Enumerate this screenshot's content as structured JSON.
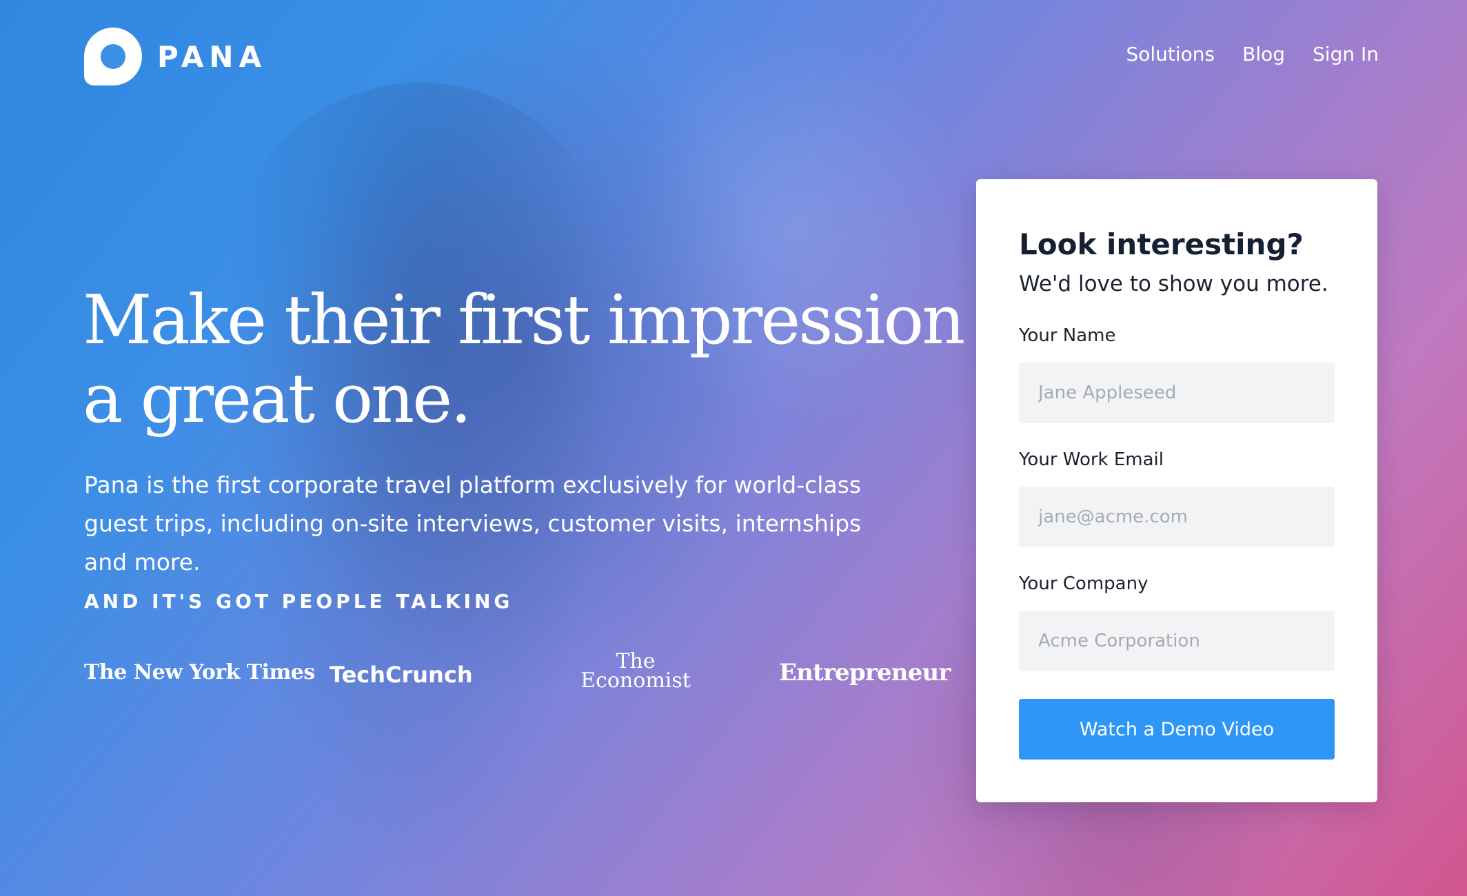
{
  "brand": {
    "name": "PANA"
  },
  "nav": {
    "items": [
      "Solutions",
      "Blog",
      "Sign In"
    ]
  },
  "hero": {
    "title_line1": "Make their first impression",
    "title_line2": "a great one.",
    "subtitle": "Pana is the first corporate travel platform exclusively for world-class guest trips, including on-site interviews, customer visits, internships and more.",
    "talking_heading": "AND IT'S GOT PEOPLE TALKING"
  },
  "press": {
    "nyt": "The New York Times",
    "techcrunch": "TechCrunch",
    "economist_line1": "The",
    "economist_line2": "Economist",
    "entrepreneur": "Entrepreneur"
  },
  "form": {
    "title": "Look interesting?",
    "subtitle": "We'd love to show you more.",
    "name_label": "Your Name",
    "name_placeholder": "Jane Appleseed",
    "email_label": "Your Work Email",
    "email_placeholder": "jane@acme.com",
    "company_label": "Your Company",
    "company_placeholder": "Acme Corporation",
    "submit_label": "Watch a Demo Video"
  },
  "colors": {
    "accent_button": "#2e96f4",
    "gradient_start": "#2f87e0",
    "gradient_end": "#d2568f"
  }
}
